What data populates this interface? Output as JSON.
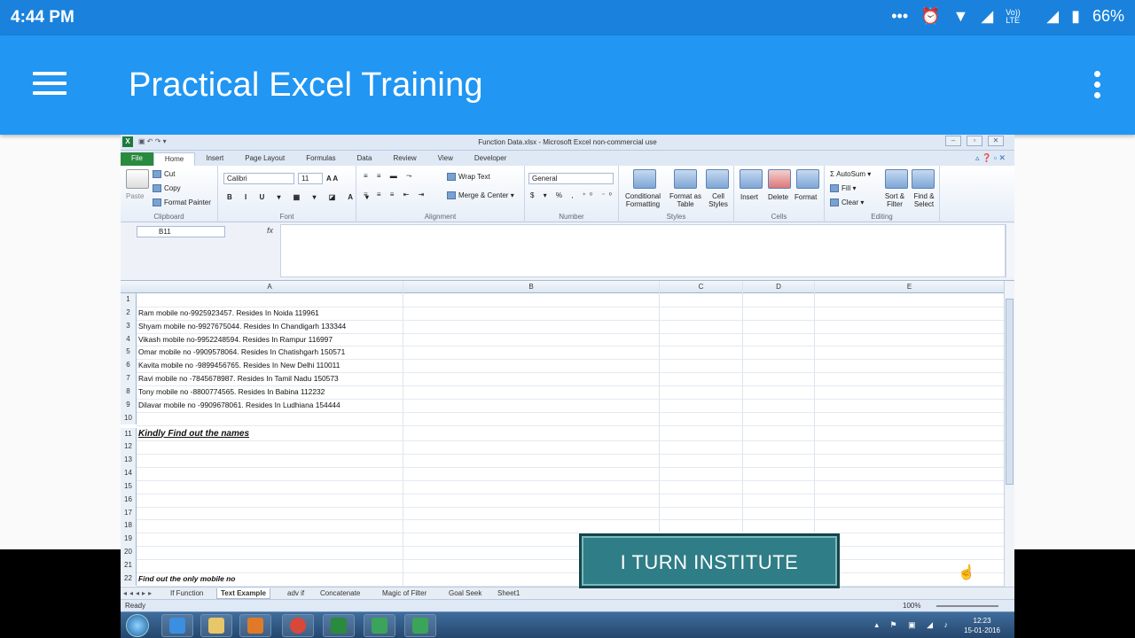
{
  "status_bar": {
    "time": "4:44 PM",
    "network": "Vo)) LTE",
    "battery": "66%"
  },
  "app_bar": {
    "title": "Practical Excel Training"
  },
  "excel": {
    "window_title": "Function Data.xlsx - Microsoft Excel non-commercial use",
    "ribbon_tabs": [
      "File",
      "Home",
      "Insert",
      "Page Layout",
      "Formulas",
      "Data",
      "Review",
      "View",
      "Developer"
    ],
    "clipboard": {
      "paste": "Paste",
      "cut": "Cut",
      "copy": "Copy",
      "format_painter": "Format Painter",
      "label": "Clipboard"
    },
    "font": {
      "name": "Calibri",
      "size": "11",
      "label": "Font"
    },
    "alignment": {
      "wrap": "Wrap Text",
      "merge": "Merge & Center",
      "label": "Alignment"
    },
    "number": {
      "format": "General",
      "label": "Number"
    },
    "styles": {
      "conditional": "Conditional Formatting",
      "format_table": "Format as Table",
      "cell_styles": "Cell Styles",
      "label": "Styles"
    },
    "cells": {
      "insert": "Insert",
      "delete": "Delete",
      "format": "Format",
      "label": "Cells"
    },
    "editing": {
      "autosum": "AutoSum",
      "fill": "Fill",
      "clear": "Clear",
      "sort": "Sort & Filter",
      "find": "Find & Select",
      "label": "Editing"
    },
    "name_box": "B11",
    "columns": [
      "A",
      "B",
      "C",
      "D",
      "E"
    ],
    "rows": [
      {
        "n": "1",
        "a": ""
      },
      {
        "n": "2",
        "a": "Ram mobile no-9925923457. Resides In Noida 119961"
      },
      {
        "n": "3",
        "a": "Shyam mobile no-9927675044. Resides In Chandigarh 133344"
      },
      {
        "n": "4",
        "a": "Vikash mobile no-9952248594. Resides In Rampur 116997"
      },
      {
        "n": "5",
        "a": "Omar mobile no -9909578064. Resides In Chatishgarh 150571"
      },
      {
        "n": "6",
        "a": "Kavita mobile no -9899456765. Resides In New Delhi 110011"
      },
      {
        "n": "7",
        "a": "Ravi mobile no -7845678987. Resides In Tamil Nadu 150573"
      },
      {
        "n": "8",
        "a": "Tony mobile no -8800774565. Resides In Babina 112232"
      },
      {
        "n": "9",
        "a": "Dilavar mobile no -9909678061. Resides In Ludhiana 154444"
      },
      {
        "n": "10",
        "a": ""
      },
      {
        "n": "11",
        "a": "Kindly Find out the names"
      },
      {
        "n": "12",
        "a": ""
      },
      {
        "n": "13",
        "a": ""
      },
      {
        "n": "14",
        "a": ""
      },
      {
        "n": "15",
        "a": ""
      },
      {
        "n": "16",
        "a": ""
      },
      {
        "n": "17",
        "a": ""
      },
      {
        "n": "18",
        "a": ""
      },
      {
        "n": "19",
        "a": ""
      },
      {
        "n": "20",
        "a": ""
      },
      {
        "n": "21",
        "a": ""
      },
      {
        "n": "22",
        "a": "Find out the only mobile no"
      }
    ],
    "sheet_tabs": [
      "If Function",
      "Text Example",
      "adv if",
      "Concatenate",
      "Magic of Filter",
      "Goal Seek",
      "Sheet1"
    ],
    "active_sheet": "Text Example",
    "status": "Ready",
    "zoom": "100%",
    "clock_time": "12:23",
    "clock_date": "15-01-2016"
  },
  "watermark": "I TURN INSTITUTE"
}
